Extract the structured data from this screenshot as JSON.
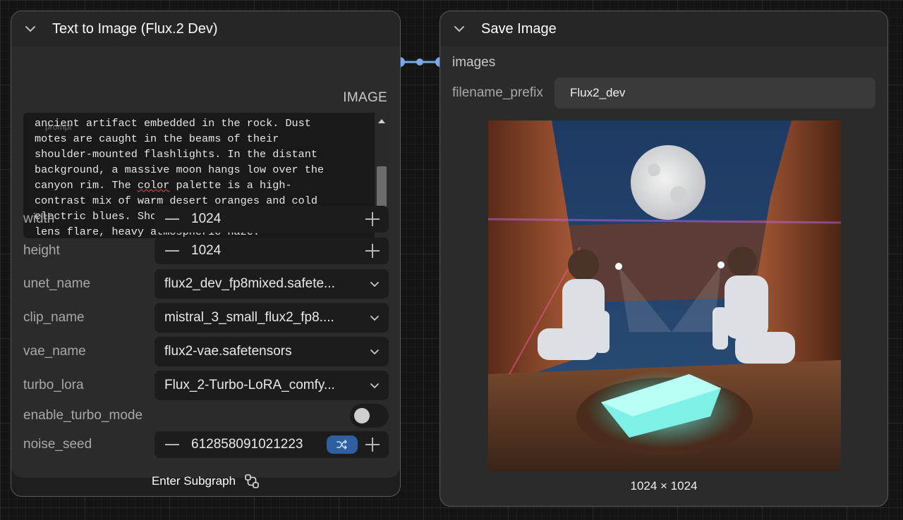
{
  "left_node": {
    "title": "Text to Image (Flux.2 Dev)",
    "output_label": "IMAGE",
    "prompt": {
      "placeholder": "prompt",
      "lines": [
        "ancient artifact embedded in the rock. Dust",
        "motes are caught in the beams of their",
        "shoulder-mounted flashlights. In the distant",
        "background, a massive moon hangs low over the",
        "canyon rim. The ",
        "color",
        " palette is a high-",
        "contrast mix of warm desert oranges and cold",
        "electric blues. Shot on 35mm film, anamorphic",
        "lens flare, heavy atmospheric haze."
      ]
    },
    "width": {
      "label": "width",
      "value": "1024"
    },
    "height": {
      "label": "height",
      "value": "1024"
    },
    "unet_name": {
      "label": "unet_name",
      "value": "flux2_dev_fp8mixed.safete..."
    },
    "clip_name": {
      "label": "clip_name",
      "value": "mistral_3_small_flux2_fp8...."
    },
    "vae_name": {
      "label": "vae_name",
      "value": "flux2-vae.safetensors"
    },
    "turbo_lora": {
      "label": "turbo_lora",
      "value": "Flux_2-Turbo-LoRA_comfy..."
    },
    "enable_turbo_mode": {
      "label": "enable_turbo_mode",
      "value": false
    },
    "noise_seed": {
      "label": "noise_seed",
      "value": "612858091021223"
    },
    "footer": {
      "label": "Enter Subgraph"
    }
  },
  "right_node": {
    "title": "Save Image",
    "input_label": "images",
    "filename_prefix": {
      "label": "filename_prefix",
      "value": "Flux2_dev"
    },
    "image_size": "1024 × 1024"
  },
  "colors": {
    "link": "#7aa9e8",
    "shuffle_bg": "#2f5f9e",
    "node_header": "#262626",
    "node_body": "#2b2b2b"
  }
}
